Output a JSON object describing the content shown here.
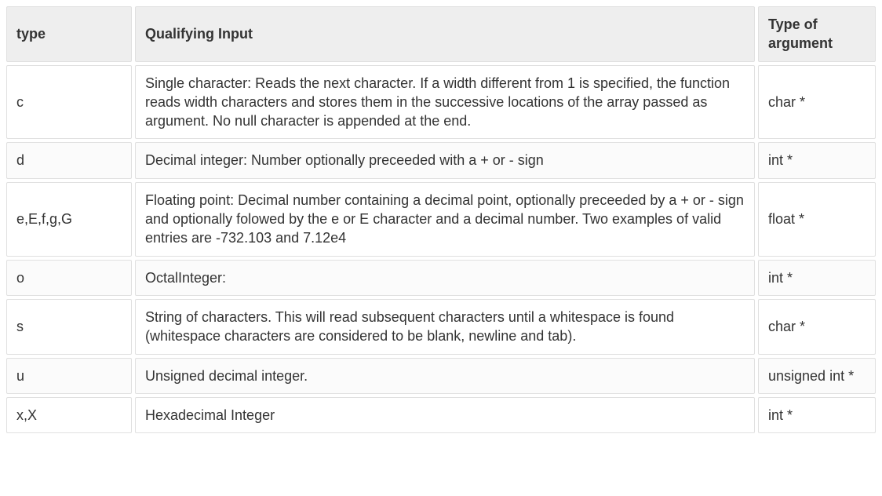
{
  "table": {
    "headers": {
      "type": "type",
      "qualifying": "Qualifying Input",
      "arg": "Type of argument"
    },
    "rows": [
      {
        "type": "c",
        "qualifying": "Single character: Reads the next character. If a width different from 1 is specified, the function reads width characters and stores them in the successive locations of the array passed as argument. No null character is appended at the end.",
        "arg": "char *"
      },
      {
        "type": "d",
        "qualifying": "Decimal integer: Number optionally preceeded with a + or - sign",
        "arg": "int *"
      },
      {
        "type": "e,E,f,g,G",
        "qualifying": "Floating point: Decimal number containing a decimal point, optionally preceeded by a + or - sign and optionally folowed by the e or E character and a decimal number. Two examples of valid entries are -732.103 and 7.12e4",
        "arg": "float *"
      },
      {
        "type": "o",
        "qualifying": "OctalInteger:",
        "arg": "int *"
      },
      {
        "type": "s",
        "qualifying": "String of characters. This will read subsequent characters until a whitespace is found (whitespace characters are considered to be blank, newline and tab).",
        "arg": "char *"
      },
      {
        "type": "u",
        "qualifying": "Unsigned decimal integer.",
        "arg": "unsigned int *"
      },
      {
        "type": "x,X",
        "qualifying": "Hexadecimal Integer",
        "arg": "int *"
      }
    ]
  }
}
